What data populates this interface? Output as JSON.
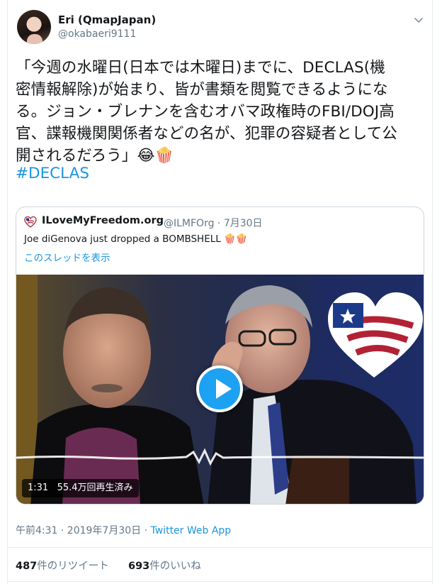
{
  "author": {
    "name": "Eri (QmapJapan)",
    "handle": "@okabaeri9111"
  },
  "tweet": {
    "lines": [
      "「今週の水曜日(日本では木曜日)までに、DECLAS(機",
      "密情報解除)が始まり、皆が書類を閲覧できるようにな",
      "る。ジョン・ブレナンを含むオバマ政権時のFBI/DOJ高",
      "官、諜報機関関係者などの名が、犯罪の容疑者として公",
      "開されるだろう」😂🍿"
    ],
    "hashtag": "#DECLAS"
  },
  "quoted": {
    "name": "ILoveMyFreedom.org",
    "handle_date": "@ILMFOrg · 7月30日",
    "text": "Joe diGenova just dropped a BOMBSHELL 🍿🍿",
    "thread_link": "このスレッドを表示",
    "video": {
      "duration_views": "1:31   55.4万回再生済み"
    }
  },
  "meta": {
    "time_date": "午前4:31 · 2019年7月30日 · ",
    "via": "Twitter Web App"
  },
  "stats": {
    "retweets_count": "487",
    "retweets_label": "件のリツイート",
    "likes_count": "693",
    "likes_label": "件のいいね"
  },
  "colors": {
    "link": "#1b95e0",
    "play_button": "#1da1f2",
    "text_secondary": "#657786"
  }
}
